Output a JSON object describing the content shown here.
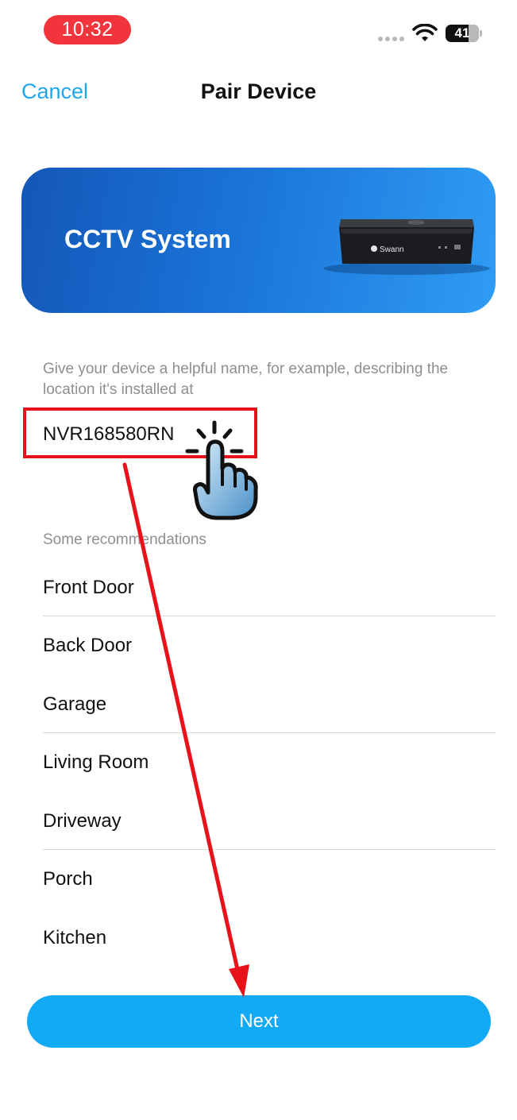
{
  "status_bar": {
    "time": "10:32",
    "battery": "41"
  },
  "nav": {
    "cancel_label": "Cancel",
    "title": "Pair Device"
  },
  "banner": {
    "title": "CCTV System",
    "device_brand": "Swann"
  },
  "form": {
    "help_text": "Give your device a helpful name, for example, describing the location it's installed at",
    "name_value": "NVR168580RN"
  },
  "recommendations": {
    "label": "Some recommendations",
    "items": [
      "Front Door",
      "Back Door",
      "Garage",
      "Living Room",
      "Driveway",
      "Porch",
      "Kitchen"
    ]
  },
  "next_button": {
    "label": "Next"
  },
  "colors": {
    "accent": "#1ea7e8",
    "button": "#12aaf4",
    "annotation": "#e8121b",
    "time_pill": "#f2343c"
  },
  "icons": [
    "signal-dots-icon",
    "wifi-icon",
    "battery-icon",
    "tap-hand-icon",
    "red-arrow-annotation"
  ]
}
